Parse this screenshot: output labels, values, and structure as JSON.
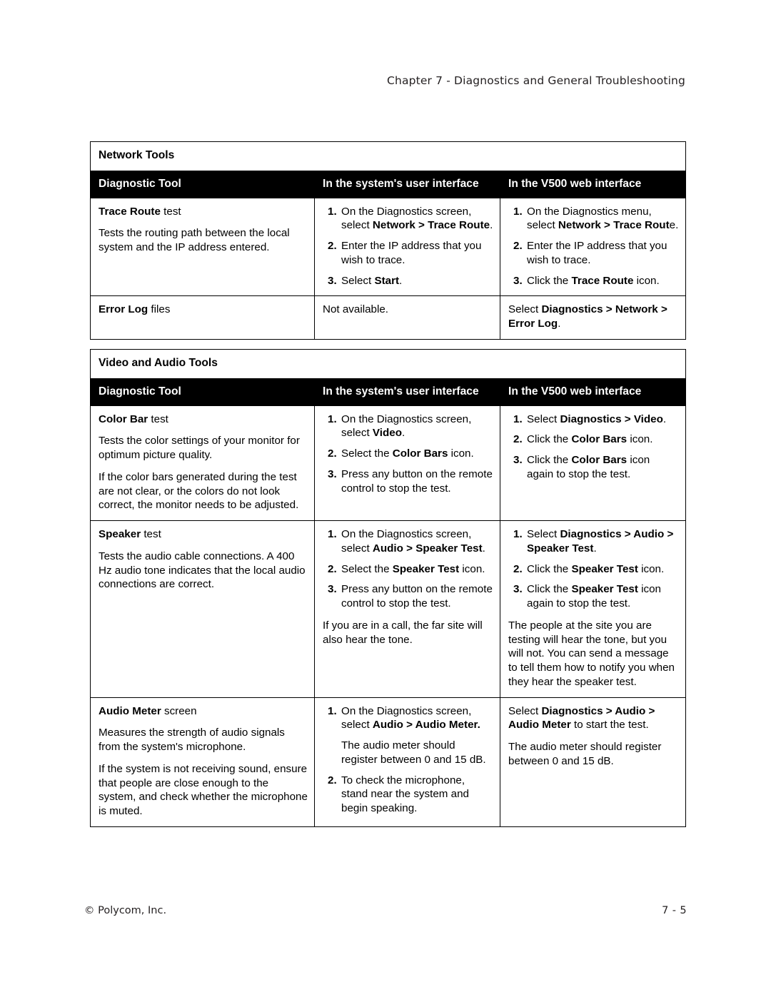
{
  "header": {
    "running_head": "Chapter 7 - Diagnostics and General Troubleshooting"
  },
  "footer": {
    "copyright": "© Polycom, Inc.",
    "page_number": "7 - 5"
  },
  "tables": [
    {
      "id": "network",
      "title": "Network Tools",
      "columns": [
        "Diagnostic Tool",
        "In the system's user interface",
        "In the V500 web interface"
      ],
      "rows": [
        {
          "tool_title_bold": "Trace Route",
          "tool_title_rest": " test",
          "tool_desc": "Tests the routing path between the local system and the IP address entered.",
          "ui_steps": [
            {
              "num": "1.",
              "parts": [
                {
                  "t": "On the Diagnostics screen, select ",
                  "b": false
                },
                {
                  "t": "Network > Trace Route",
                  "b": true
                },
                {
                  "t": ".",
                  "b": false
                }
              ]
            },
            {
              "num": "2.",
              "parts": [
                {
                  "t": "Enter the IP address that you wish to trace.",
                  "b": false
                }
              ]
            },
            {
              "num": "3.",
              "parts": [
                {
                  "t": "Select ",
                  "b": false
                },
                {
                  "t": "Start",
                  "b": true
                },
                {
                  "t": ".",
                  "b": false
                }
              ]
            }
          ],
          "web_steps": [
            {
              "num": "1.",
              "parts": [
                {
                  "t": "On the Diagnostics menu, select ",
                  "b": false
                },
                {
                  "t": "Network > Trace Rout",
                  "b": true
                },
                {
                  "t": "e.",
                  "b": false
                }
              ]
            },
            {
              "num": "2.",
              "parts": [
                {
                  "t": "Enter the IP address that you wish to trace.",
                  "b": false
                }
              ]
            },
            {
              "num": "3.",
              "parts": [
                {
                  "t": "Click the ",
                  "b": false
                },
                {
                  "t": "Trace Route",
                  "b": true
                },
                {
                  "t": " icon.",
                  "b": false
                }
              ]
            }
          ]
        },
        {
          "tool_title_bold": "Error Log",
          "tool_title_rest": " files",
          "tool_desc": "",
          "ui_plain": [
            [
              {
                "t": "Not available.",
                "b": false
              }
            ]
          ],
          "web_plain": [
            [
              {
                "t": "Select ",
                "b": false
              },
              {
                "t": "Diagnostics > Network > Error Log",
                "b": true
              },
              {
                "t": ".",
                "b": false
              }
            ]
          ]
        }
      ]
    },
    {
      "id": "video",
      "title": "Video and Audio Tools",
      "columns": [
        "Diagnostic Tool",
        "In the system's user interface",
        "In the V500 web interface"
      ],
      "rows": [
        {
          "tool_title_bold": "Color Bar",
          "tool_title_rest": " test",
          "tool_desc": "Tests the color settings of your monitor for optimum picture quality.",
          "tool_desc2": "If the color bars generated during the test are not clear, or the colors do not look correct, the monitor needs to be adjusted.",
          "ui_steps": [
            {
              "num": "1.",
              "parts": [
                {
                  "t": "On the Diagnostics screen, select ",
                  "b": false
                },
                {
                  "t": "Video",
                  "b": true
                },
                {
                  "t": ".",
                  "b": false
                }
              ]
            },
            {
              "num": "2.",
              "parts": [
                {
                  "t": "Select the ",
                  "b": false
                },
                {
                  "t": "Color Bars",
                  "b": true
                },
                {
                  "t": " icon.",
                  "b": false
                }
              ]
            },
            {
              "num": "3.",
              "parts": [
                {
                  "t": "Press any button on the remote control to stop the test.",
                  "b": false
                }
              ]
            }
          ],
          "web_steps": [
            {
              "num": "1.",
              "parts": [
                {
                  "t": "Select ",
                  "b": false
                },
                {
                  "t": "Diagnostics > Video",
                  "b": true
                },
                {
                  "t": ".",
                  "b": false
                }
              ]
            },
            {
              "num": "2.",
              "parts": [
                {
                  "t": "Click the ",
                  "b": false
                },
                {
                  "t": "Color Bars",
                  "b": true
                },
                {
                  "t": " icon.",
                  "b": false
                }
              ]
            },
            {
              "num": "3.",
              "parts": [
                {
                  "t": "Click the ",
                  "b": false
                },
                {
                  "t": "Color Bars",
                  "b": true
                },
                {
                  "t": " icon again to stop the test.",
                  "b": false
                }
              ]
            }
          ]
        },
        {
          "tool_title_bold": "Speaker",
          "tool_title_rest": " test",
          "tool_desc": "Tests the audio cable connections. A 400 Hz audio tone indicates that the local audio connections are correct.",
          "ui_steps": [
            {
              "num": "1.",
              "parts": [
                {
                  "t": "On the Diagnostics screen, select ",
                  "b": false
                },
                {
                  "t": "Audio > Speaker Test",
                  "b": true
                },
                {
                  "t": ".",
                  "b": false
                }
              ]
            },
            {
              "num": "2.",
              "parts": [
                {
                  "t": "Select the ",
                  "b": false
                },
                {
                  "t": "Speaker Test",
                  "b": true
                },
                {
                  "t": " icon.",
                  "b": false
                }
              ]
            },
            {
              "num": "3.",
              "parts": [
                {
                  "t": "Press any button on the remote control to stop the test.",
                  "b": false
                }
              ]
            }
          ],
          "ui_after": [
            [
              {
                "t": "If you are in a call, the far site will also hear the tone.",
                "b": false
              }
            ]
          ],
          "web_steps": [
            {
              "num": "1.",
              "parts": [
                {
                  "t": "Select ",
                  "b": false
                },
                {
                  "t": "Diagnostics > Audio > Speaker Test",
                  "b": true
                },
                {
                  "t": ".",
                  "b": false
                }
              ]
            },
            {
              "num": "2.",
              "parts": [
                {
                  "t": "Click the ",
                  "b": false
                },
                {
                  "t": "Speaker Test",
                  "b": true
                },
                {
                  "t": " icon.",
                  "b": false
                }
              ]
            },
            {
              "num": "3.",
              "parts": [
                {
                  "t": "Click the ",
                  "b": false
                },
                {
                  "t": "Speaker Test",
                  "b": true
                },
                {
                  "t": " icon again to stop the test.",
                  "b": false
                }
              ]
            }
          ],
          "web_after": [
            [
              {
                "t": "The people at the site you are testing will hear the tone, but you will not. You can send a message to tell them how to notify you when they hear the speaker test.",
                "b": false
              }
            ]
          ]
        },
        {
          "tool_title_bold": "Audio Meter",
          "tool_title_rest": " screen",
          "tool_desc": "Measures the strength of audio signals from the system's microphone.",
          "tool_desc2": "If the system is not receiving sound, ensure that people are close enough to the system, and check whether the microphone is muted.",
          "ui_steps": [
            {
              "num": "1.",
              "parts": [
                {
                  "t": "On the Diagnostics screen, select ",
                  "b": false
                },
                {
                  "t": "Audio > Audio Meter.",
                  "b": true
                }
              ],
              "sub": [
                {
                  "t": "The audio meter should register between 0 and 15 dB.",
                  "b": false
                }
              ]
            },
            {
              "num": "2.",
              "parts": [
                {
                  "t": "To check the microphone, stand near the system and begin speaking.",
                  "b": false
                }
              ]
            }
          ],
          "web_plain": [
            [
              {
                "t": "Select ",
                "b": false
              },
              {
                "t": "Diagnostics > Audio > Audio Meter",
                "b": true
              },
              {
                "t": " to start the test.",
                "b": false
              }
            ],
            [
              {
                "t": "The audio meter should register between 0 and 15 dB.",
                "b": false
              }
            ]
          ]
        }
      ]
    }
  ]
}
